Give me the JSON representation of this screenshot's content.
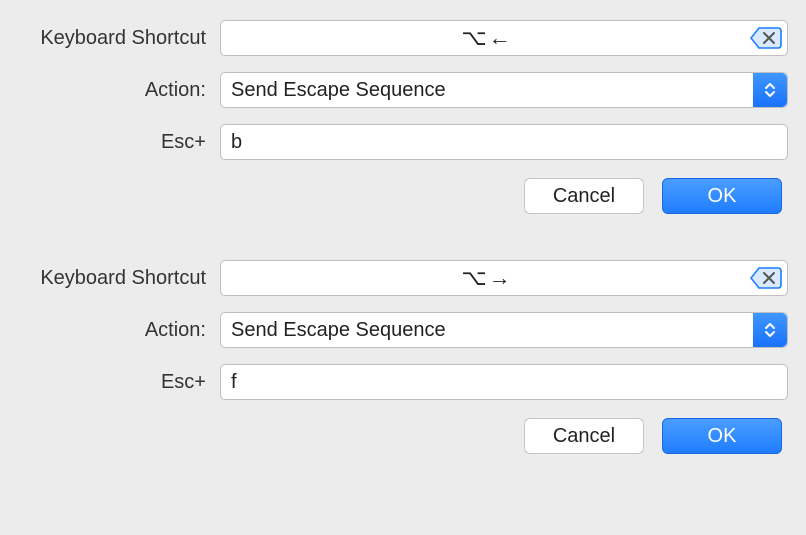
{
  "blocks": [
    {
      "shortcut_label": "Keyboard Shortcut",
      "shortcut_value": "⌥←",
      "action_label": "Action:",
      "action_value": "Send Escape Sequence",
      "esc_label": "Esc+",
      "esc_value": "b",
      "cancel": "Cancel",
      "ok": "OK"
    },
    {
      "shortcut_label": "Keyboard Shortcut",
      "shortcut_value": "⌥→",
      "action_label": "Action:",
      "action_value": "Send Escape Sequence",
      "esc_label": "Esc+",
      "esc_value": "f",
      "cancel": "Cancel",
      "ok": "OK"
    }
  ]
}
